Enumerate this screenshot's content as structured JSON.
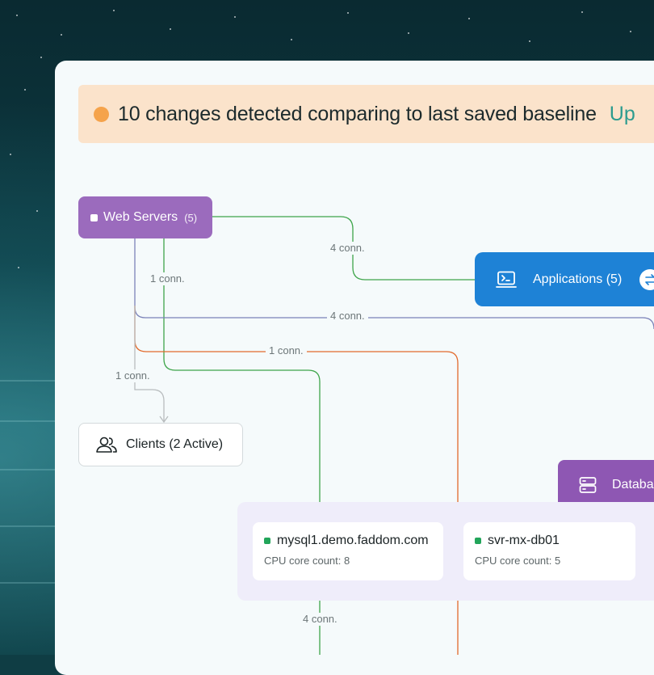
{
  "banner": {
    "message": "10 changes detected comparing to last saved baseline",
    "link_label": "Up",
    "dot_color": "#f5a34b"
  },
  "nodes": {
    "web_servers": {
      "label": "Web Servers",
      "count": "(5)",
      "color": "#9b6bbd"
    },
    "applications": {
      "label": "Applications (5)",
      "color": "#1e82d6",
      "icon": "terminal-window-icon"
    },
    "clients": {
      "label": "Clients (2 Active)",
      "icon": "users-icon"
    },
    "databases": {
      "label": "Databa",
      "color": "#8e57b3",
      "icon": "server-stack-icon"
    }
  },
  "connections": [
    {
      "label": "4 conn.",
      "color": "#3ea54a"
    },
    {
      "label": "1 conn.",
      "color": "#3ea54a"
    },
    {
      "label": "4 conn.",
      "color": "#7b82b8"
    },
    {
      "label": "1 conn.",
      "color": "#e26a2c"
    },
    {
      "label": "1 conn.",
      "color": "#b8bcbe"
    },
    {
      "label": "4 conn.",
      "color": "#3ea54a"
    }
  ],
  "db_cards": [
    {
      "name": "mysql1.demo.faddom.com",
      "detail": "CPU core count: 8"
    },
    {
      "name": "svr-mx-db01",
      "detail": "CPU core count: 5"
    }
  ]
}
